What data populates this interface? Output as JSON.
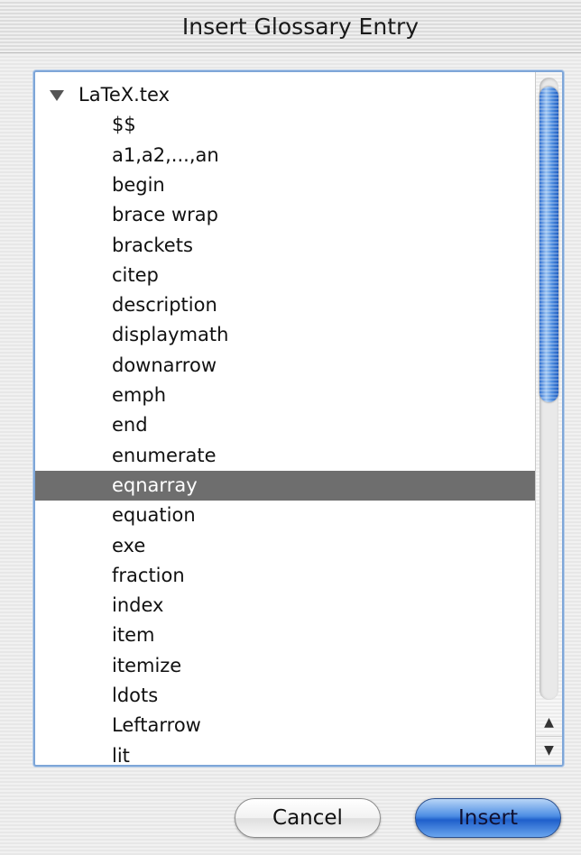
{
  "window": {
    "title": "Insert Glossary Entry"
  },
  "tree": {
    "root_label": "LaTeX.tex",
    "expanded": true,
    "items": [
      "$$",
      "a1,a2,...,an",
      "begin",
      "brace wrap",
      "brackets",
      "citep",
      "description",
      "displaymath",
      "downarrow",
      "emph",
      "end",
      "enumerate",
      "eqnarray",
      "equation",
      "exe",
      "fraction",
      "index",
      "item",
      "itemize",
      "ldots",
      "Leftarrow",
      "lit"
    ],
    "selected_item": "eqnarray"
  },
  "scrollbar": {
    "up_arrow": "▲",
    "down_arrow": "▼"
  },
  "buttons": {
    "cancel_label": "Cancel",
    "insert_label": "Insert"
  },
  "colors": {
    "selection": "#6e6e6e",
    "focus_ring": "#7ea6d8",
    "default_button": "#1f5fcb"
  },
  "icons": {
    "disclosure": "disclosure-triangle-down-icon"
  }
}
